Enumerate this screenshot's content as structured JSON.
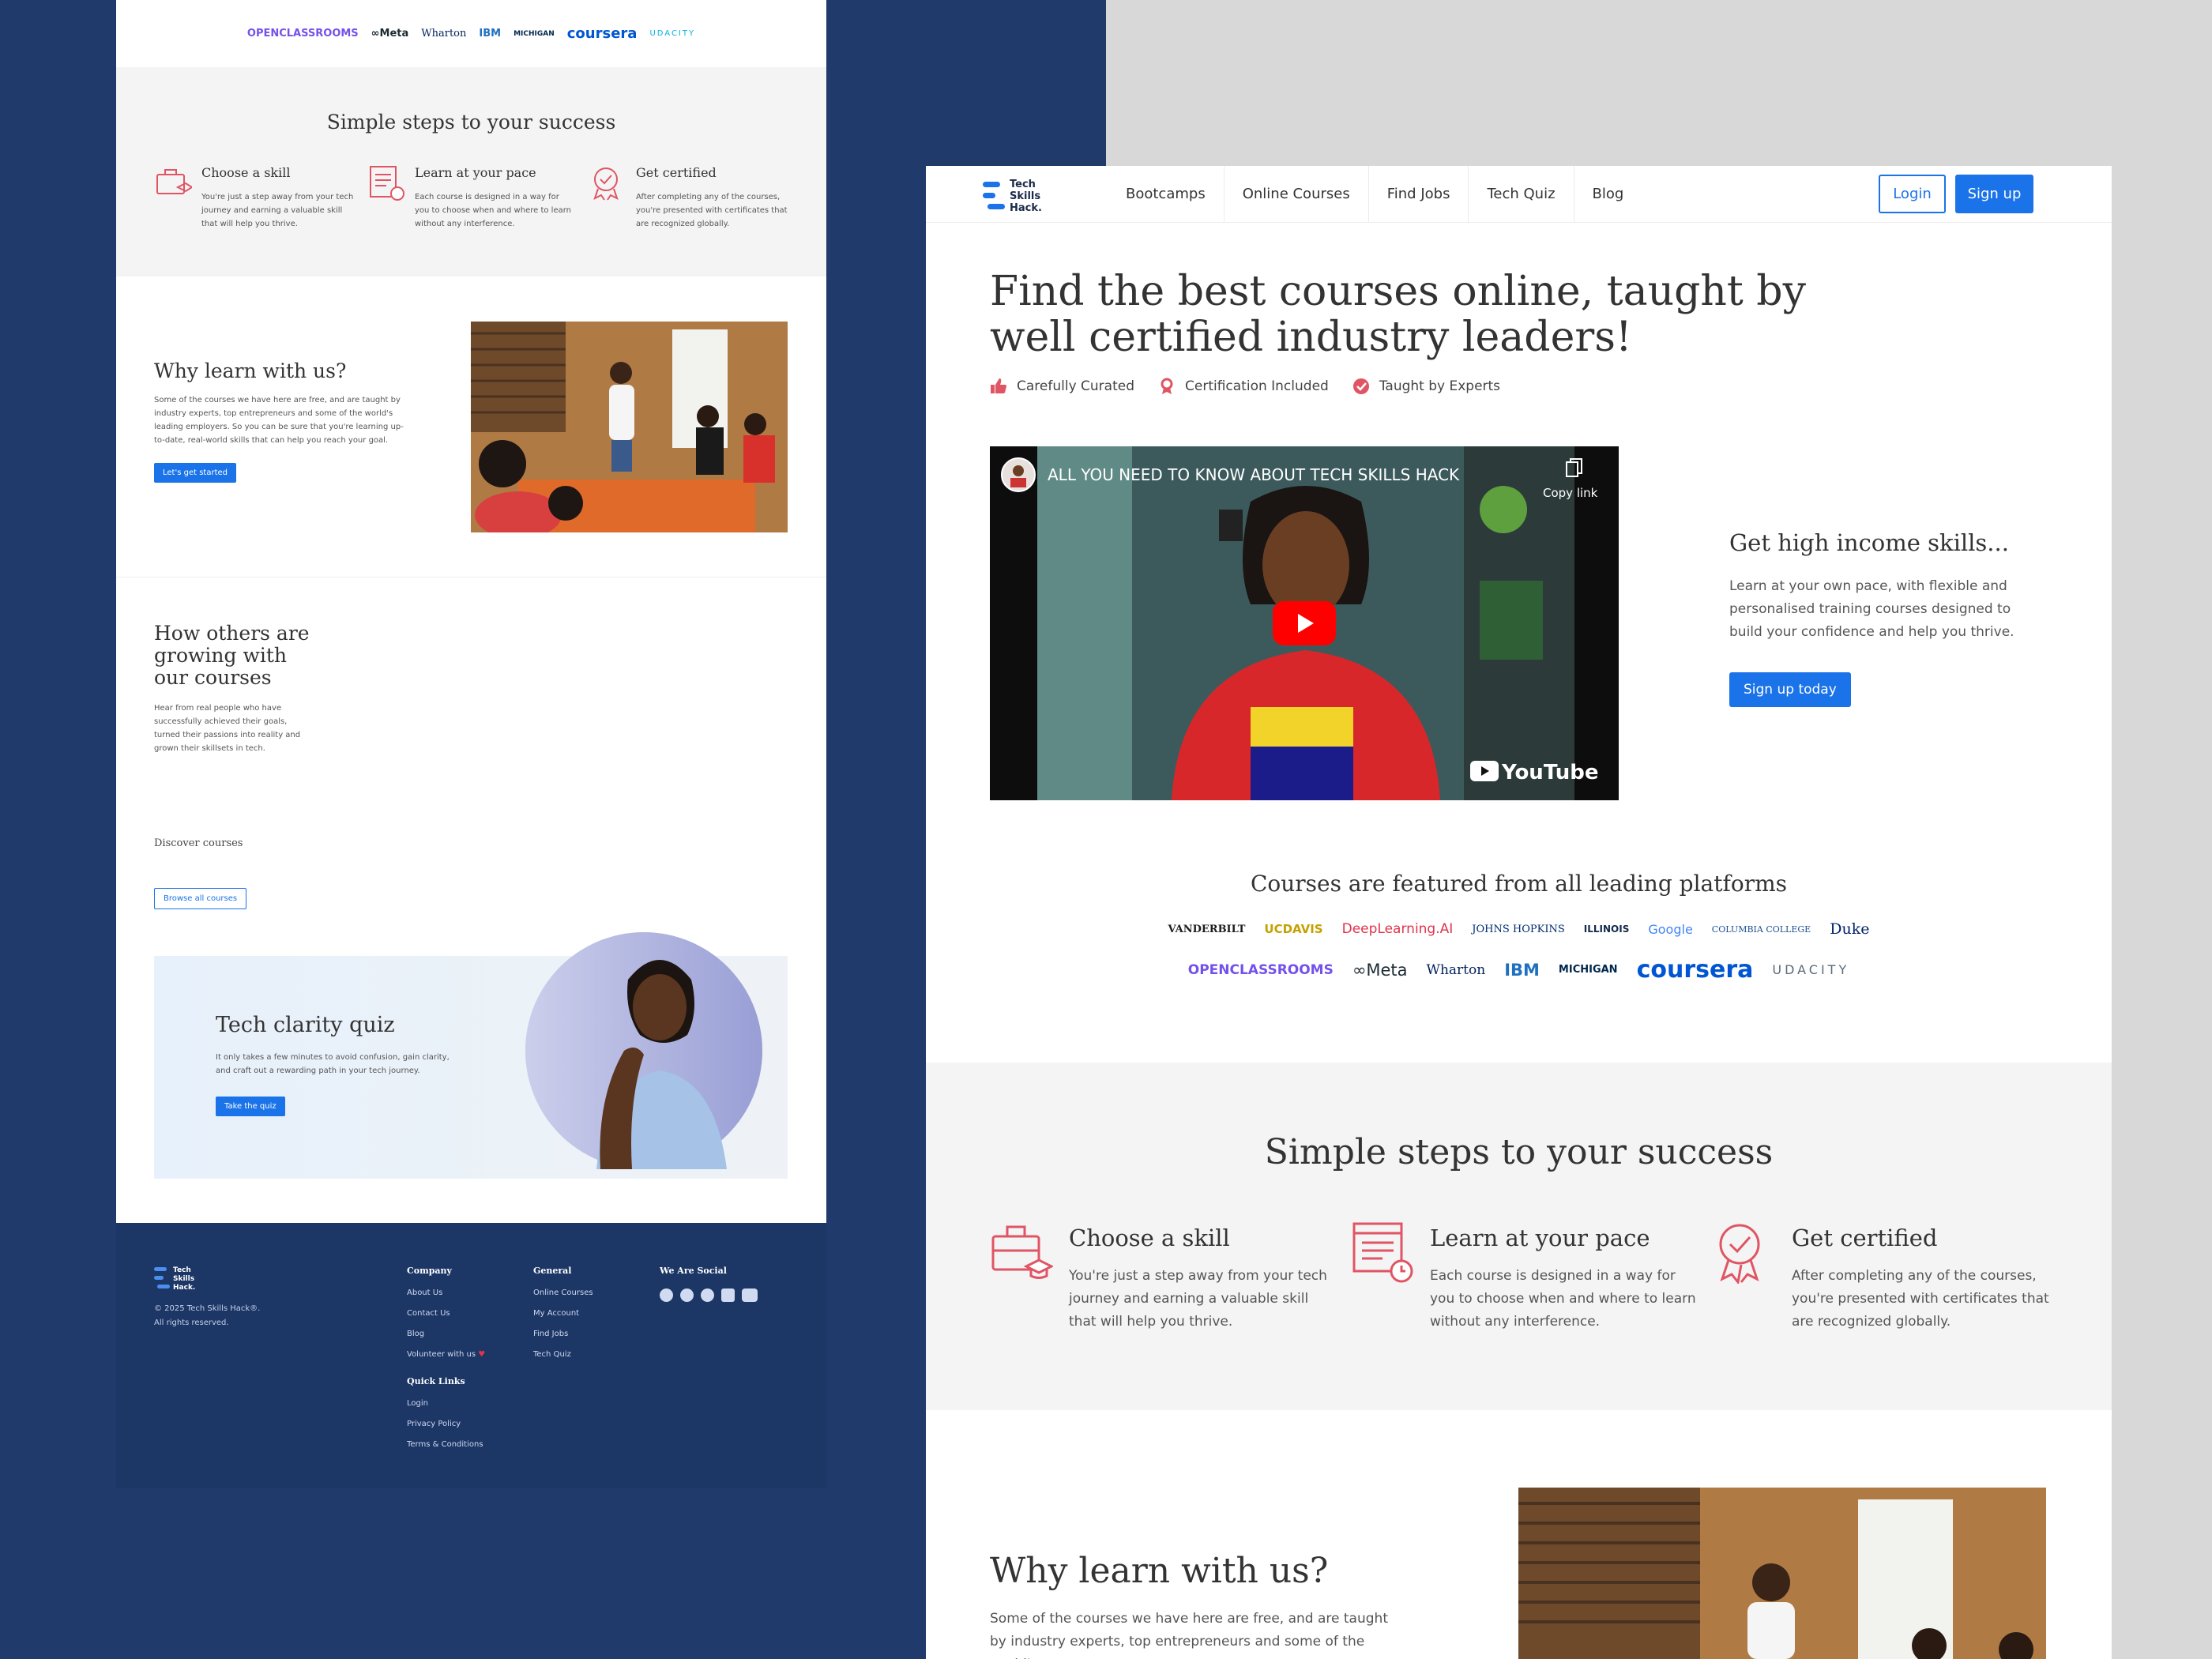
{
  "colors": {
    "accent": "#1a73e8",
    "navy": "#1f3a6b",
    "icon_red": "#e05563"
  },
  "brand": {
    "logo_lines": [
      "Tech",
      "Skills",
      "Hack."
    ]
  },
  "left": {
    "logos": [
      {
        "text": "OPENCLASSROOMS",
        "color": "#7451eb"
      },
      {
        "text": "∞Meta",
        "color": "#1c2b33"
      },
      {
        "text": "Wharton",
        "color": "#00205b"
      },
      {
        "text": "IBM",
        "color": "#1f70c1"
      },
      {
        "text": "MICHIGAN",
        "color": "#00274c"
      },
      {
        "text": "coursera",
        "color": "#0056d2"
      },
      {
        "text": "UDACITY",
        "color": "#02b3e4"
      }
    ],
    "steps_title": "Simple steps to your success",
    "steps": [
      {
        "title": "Choose a skill",
        "text": "You're just a step away from your tech journey and earning a valuable skill that will help you thrive."
      },
      {
        "title": "Learn at your pace",
        "text": "Each course is designed in a way for you to choose when and where to learn without any interference."
      },
      {
        "title": "Get certified",
        "text": "After completing any of the courses, you're presented with certificates that are recognized globally."
      }
    ],
    "why_title": "Why learn with us?",
    "why_text": "Some of the courses we have here are free, and are taught by industry experts, top entrepreneurs and some of the world's leading employers. So you can be sure that you're learning up-to-date, real-world skills that can help you reach your goal.",
    "why_button": "Let's get started",
    "others_title": "How others are growing with our courses",
    "others_text": "Hear from real people who have successfully achieved their goals, turned their passions into reality and grown their skillsets in tech.",
    "discover": "Discover courses",
    "browse_button": "Browse all courses",
    "quiz_title": "Tech clarity quiz",
    "quiz_text": "It only takes a few minutes to avoid confusion, gain clarity, and craft out a rewarding path in your tech journey.",
    "quiz_button": "Take the quiz"
  },
  "footer": {
    "copyright": "© 2025 Tech Skills Hack®.",
    "rights": "All rights reserved.",
    "company": {
      "title": "Company",
      "items": [
        "About Us",
        "Contact Us",
        "Blog",
        "Volunteer with us"
      ]
    },
    "general": {
      "title": "General",
      "items": [
        "Online Courses",
        "My Account",
        "Find Jobs",
        "Tech Quiz"
      ]
    },
    "quick": {
      "title": "Quick Links",
      "items": [
        "Login",
        "Privacy Policy",
        "Terms & Conditions"
      ]
    },
    "social": {
      "title": "We Are Social",
      "icons": [
        "facebook-icon",
        "instagram-icon",
        "twitter-icon",
        "linkedin-icon",
        "youtube-icon"
      ]
    }
  },
  "right": {
    "nav": [
      "Bootcamps",
      "Online Courses",
      "Find Jobs",
      "Tech Quiz",
      "Blog"
    ],
    "login": "Login",
    "signup": "Sign up",
    "hero_title": "Find the best courses online, taught by well certified industry leaders!",
    "features": [
      "Carefully Curated",
      "Certification Included",
      "Taught by Experts"
    ],
    "video_title": "ALL YOU NEED TO KNOW ABOUT TECH SKILLS HACK",
    "copy_link": "Copy link",
    "youtube": "YouTube",
    "income_title": "Get high income skills...",
    "income_text": "Learn at your own pace, with flexible and personalised training courses designed to build your confidence and help you thrive.",
    "income_button": "Sign up today",
    "platforms_title": "Courses are featured from all leading platforms",
    "platforms_row1": [
      {
        "text": "VANDERBILT",
        "color": "#1c1c1c"
      },
      {
        "text": "UCDAVIS",
        "color": "#c5a100"
      },
      {
        "text": "DeepLearning.AI",
        "color": "#e0344b"
      },
      {
        "text": "JOHNS HOPKINS",
        "color": "#002d72"
      },
      {
        "text": "ILLINOIS",
        "color": "#13294b"
      },
      {
        "text": "Google",
        "color": "#4285f4"
      },
      {
        "text": "COLUMBIA COLLEGE",
        "color": "#1d4f91"
      },
      {
        "text": "Duke",
        "color": "#012169"
      }
    ],
    "platforms_row2": [
      {
        "text": "OPENCLASSROOMS",
        "color": "#7451eb"
      },
      {
        "text": "∞Meta",
        "color": "#1c2b33"
      },
      {
        "text": "Wharton",
        "color": "#00205b"
      },
      {
        "text": "IBM",
        "color": "#1f70c1"
      },
      {
        "text": "MICHIGAN",
        "color": "#00274c"
      },
      {
        "text": "coursera",
        "color": "#0056d2"
      },
      {
        "text": "UDACITY",
        "color": "#5a6b78"
      }
    ],
    "steps_title": "Simple steps to your success",
    "steps": [
      {
        "title": "Choose a skill",
        "text": "You're just a step away from your tech journey and earning a valuable skill that will help you thrive."
      },
      {
        "title": "Learn at your pace",
        "text": "Each course is designed in a way for you to choose when and where to learn without any interference."
      },
      {
        "title": "Get certified",
        "text": "After completing any of the courses, you're presented with certificates that are recognized globally."
      }
    ],
    "why_title": "Why learn with us?",
    "why_text": "Some of the courses we have here are free, and are taught by industry experts, top entrepreneurs and some of the world's"
  }
}
